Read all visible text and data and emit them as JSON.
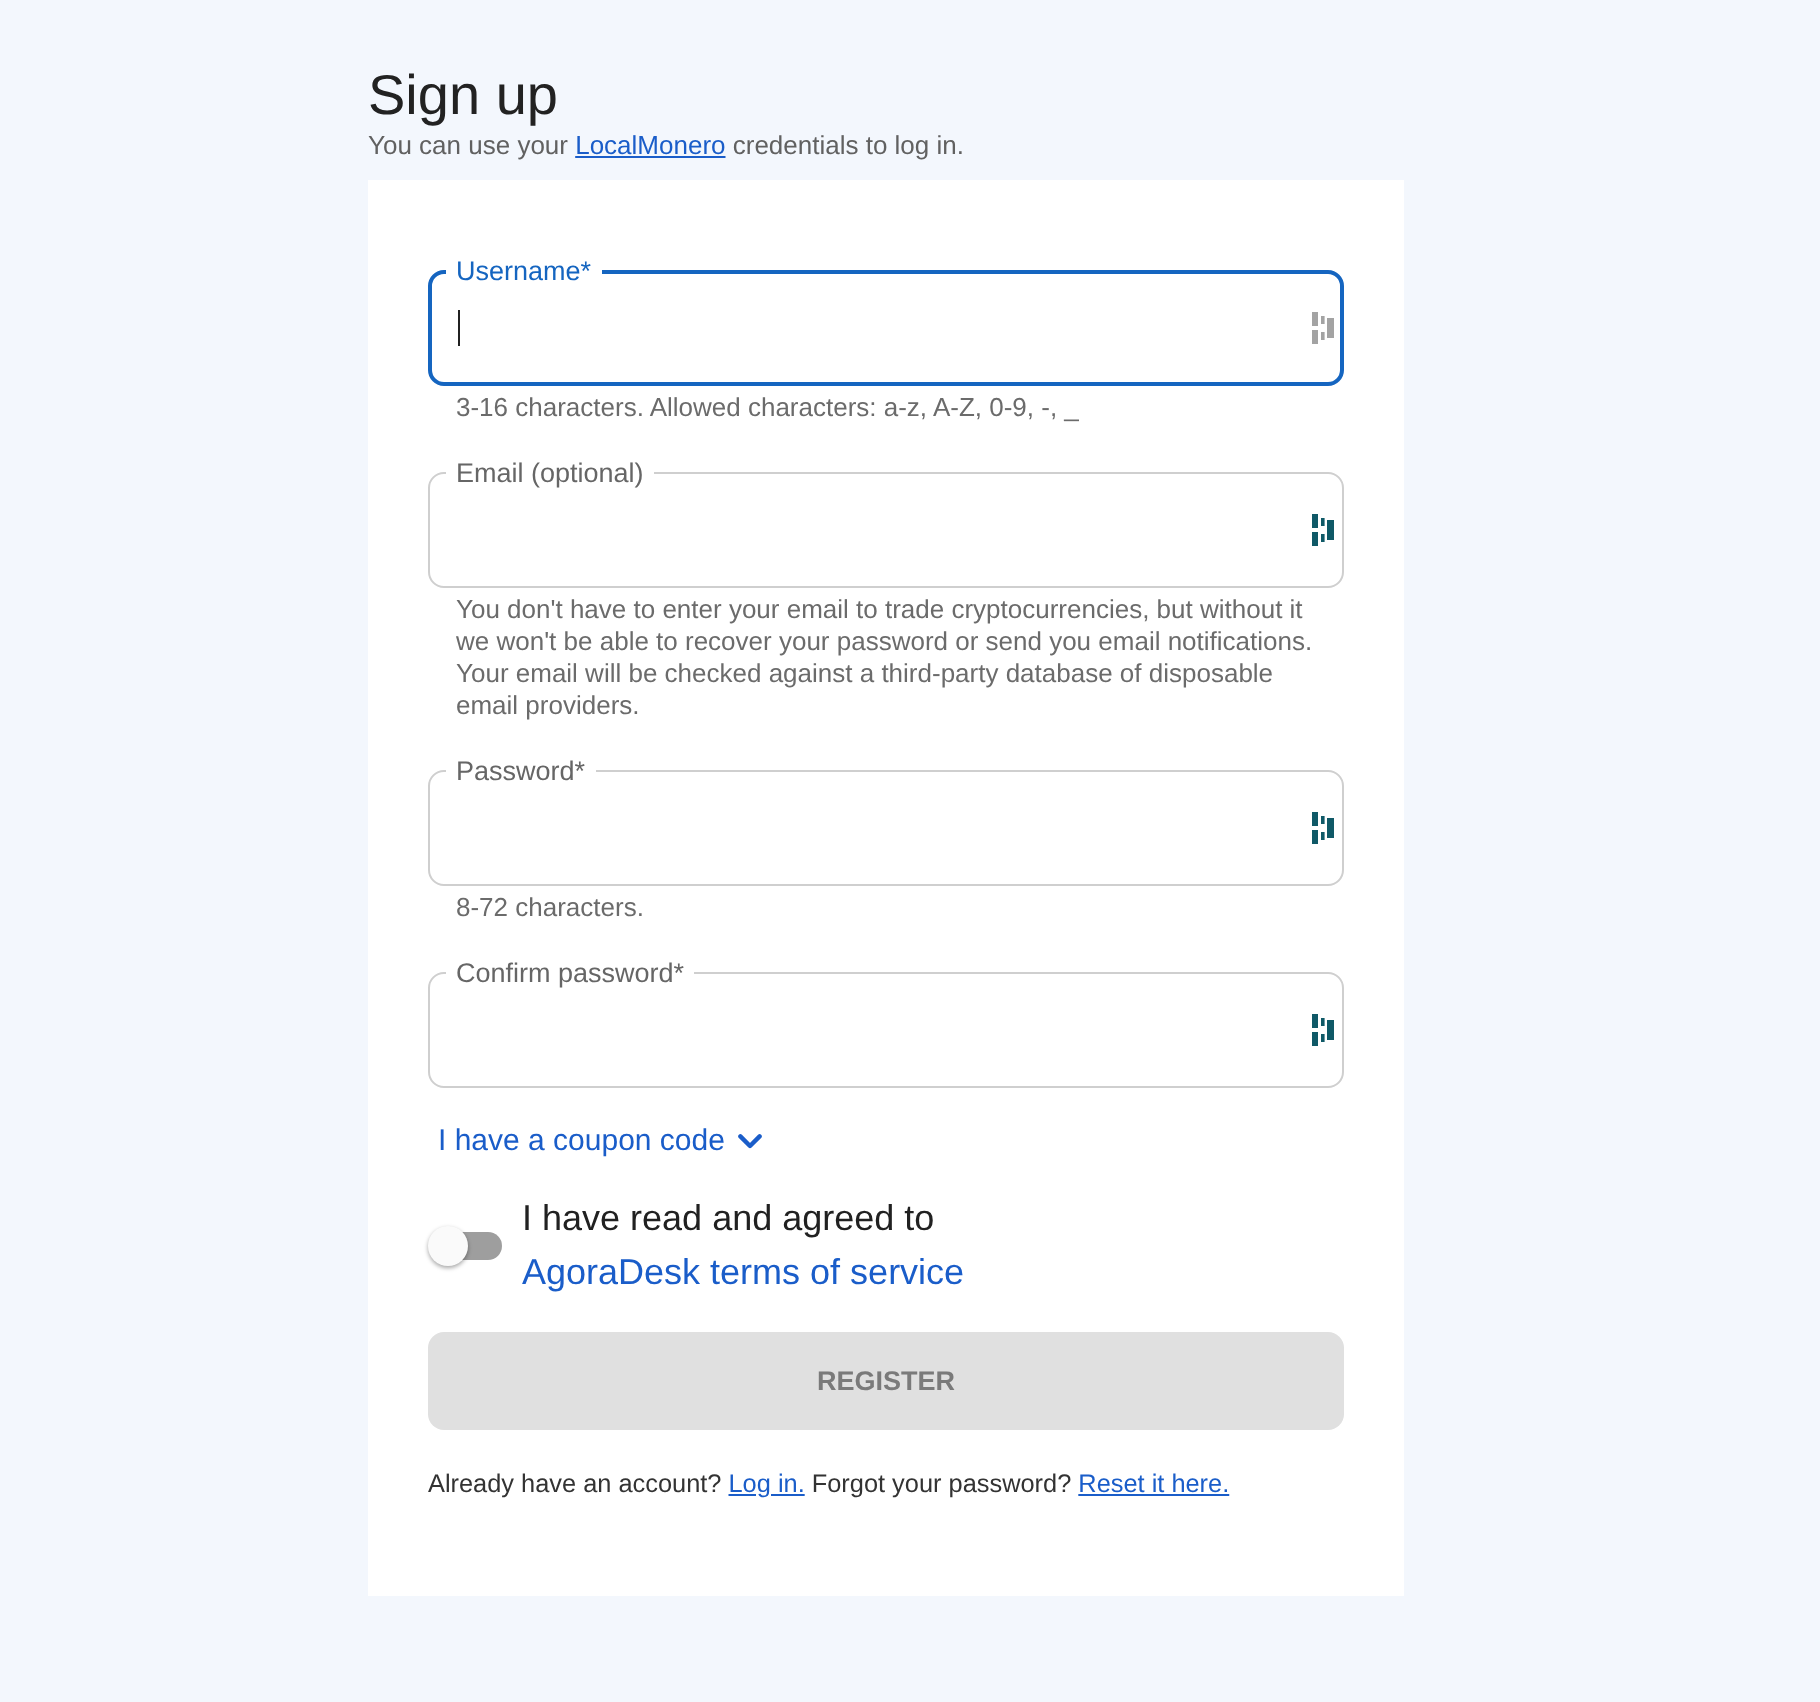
{
  "header": {
    "title": "Sign up",
    "subtitle": {
      "text_before": "You can use your ",
      "link": "LocalMonero",
      "text_after": " credentials to log in."
    }
  },
  "form": {
    "fields": [
      {
        "label": "Username*",
        "focused": true,
        "helper": "3-16 characters. Allowed characters: a-z, A-Z, 0-9, -, _"
      },
      {
        "label": "Email (optional)",
        "focused": false,
        "helper": "You don't have to enter your email to trade cryptocurrencies, but without it we won't be able to recover your password or send you email notifications. Your email will be checked against a third-party database of disposable email providers."
      },
      {
        "label": "Password*",
        "focused": false,
        "helper": "8-72 characters."
      },
      {
        "label": "Confirm password*",
        "focused": false
      }
    ],
    "coupon": {
      "label": "I have a coupon code",
      "expanded": false
    },
    "terms": {
      "on": false,
      "text": "I have read and agreed to ",
      "link": "AgoraDesk terms of service"
    },
    "register_button": {
      "label": "REGISTER",
      "disabled": true
    },
    "footer": [
      {
        "kind": "text",
        "text": "Already have an account? "
      },
      {
        "kind": "link",
        "text": "Log in."
      },
      {
        "kind": "text",
        "text": " Forgot your password? "
      },
      {
        "kind": "link",
        "text": "Reset it here."
      }
    ]
  }
}
